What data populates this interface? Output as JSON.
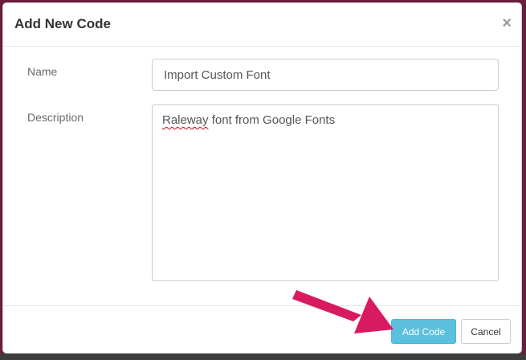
{
  "modal": {
    "title": "Add New Code",
    "close_symbol": "×"
  },
  "form": {
    "name_label": "Name",
    "name_value": "Import Custom Font",
    "description_label": "Description",
    "description_misspelled_word": "Raleway",
    "description_rest": " font from Google Fonts"
  },
  "footer": {
    "add_label": "Add Code",
    "cancel_label": "Cancel"
  },
  "colors": {
    "primary_button": "#5bc0de",
    "annotation_arrow": "#d81b60",
    "backdrop": "#6b1d3d"
  },
  "annotation": {
    "icon": "pointer-arrow-icon"
  }
}
